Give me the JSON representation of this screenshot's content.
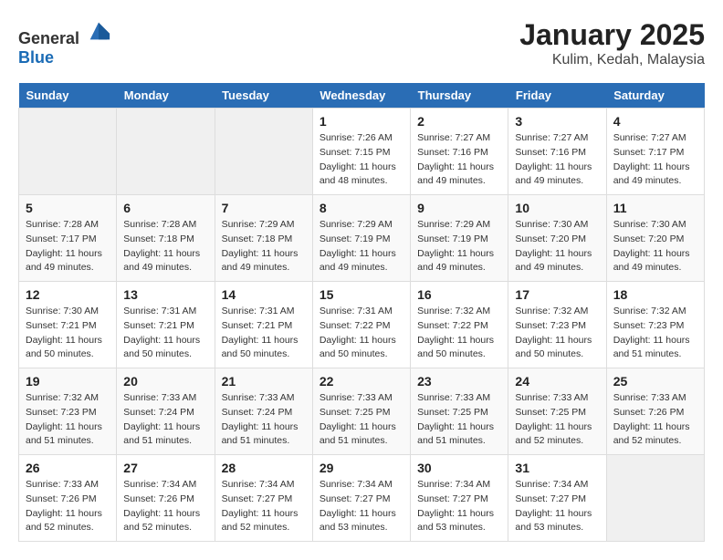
{
  "logo": {
    "text_general": "General",
    "text_blue": "Blue"
  },
  "title": "January 2025",
  "subtitle": "Kulim, Kedah, Malaysia",
  "headers": [
    "Sunday",
    "Monday",
    "Tuesday",
    "Wednesday",
    "Thursday",
    "Friday",
    "Saturday"
  ],
  "weeks": [
    [
      {
        "day": "",
        "info": ""
      },
      {
        "day": "",
        "info": ""
      },
      {
        "day": "",
        "info": ""
      },
      {
        "day": "1",
        "info": "Sunrise: 7:26 AM\nSunset: 7:15 PM\nDaylight: 11 hours\nand 48 minutes."
      },
      {
        "day": "2",
        "info": "Sunrise: 7:27 AM\nSunset: 7:16 PM\nDaylight: 11 hours\nand 49 minutes."
      },
      {
        "day": "3",
        "info": "Sunrise: 7:27 AM\nSunset: 7:16 PM\nDaylight: 11 hours\nand 49 minutes."
      },
      {
        "day": "4",
        "info": "Sunrise: 7:27 AM\nSunset: 7:17 PM\nDaylight: 11 hours\nand 49 minutes."
      }
    ],
    [
      {
        "day": "5",
        "info": "Sunrise: 7:28 AM\nSunset: 7:17 PM\nDaylight: 11 hours\nand 49 minutes."
      },
      {
        "day": "6",
        "info": "Sunrise: 7:28 AM\nSunset: 7:18 PM\nDaylight: 11 hours\nand 49 minutes."
      },
      {
        "day": "7",
        "info": "Sunrise: 7:29 AM\nSunset: 7:18 PM\nDaylight: 11 hours\nand 49 minutes."
      },
      {
        "day": "8",
        "info": "Sunrise: 7:29 AM\nSunset: 7:19 PM\nDaylight: 11 hours\nand 49 minutes."
      },
      {
        "day": "9",
        "info": "Sunrise: 7:29 AM\nSunset: 7:19 PM\nDaylight: 11 hours\nand 49 minutes."
      },
      {
        "day": "10",
        "info": "Sunrise: 7:30 AM\nSunset: 7:20 PM\nDaylight: 11 hours\nand 49 minutes."
      },
      {
        "day": "11",
        "info": "Sunrise: 7:30 AM\nSunset: 7:20 PM\nDaylight: 11 hours\nand 49 minutes."
      }
    ],
    [
      {
        "day": "12",
        "info": "Sunrise: 7:30 AM\nSunset: 7:21 PM\nDaylight: 11 hours\nand 50 minutes."
      },
      {
        "day": "13",
        "info": "Sunrise: 7:31 AM\nSunset: 7:21 PM\nDaylight: 11 hours\nand 50 minutes."
      },
      {
        "day": "14",
        "info": "Sunrise: 7:31 AM\nSunset: 7:21 PM\nDaylight: 11 hours\nand 50 minutes."
      },
      {
        "day": "15",
        "info": "Sunrise: 7:31 AM\nSunset: 7:22 PM\nDaylight: 11 hours\nand 50 minutes."
      },
      {
        "day": "16",
        "info": "Sunrise: 7:32 AM\nSunset: 7:22 PM\nDaylight: 11 hours\nand 50 minutes."
      },
      {
        "day": "17",
        "info": "Sunrise: 7:32 AM\nSunset: 7:23 PM\nDaylight: 11 hours\nand 50 minutes."
      },
      {
        "day": "18",
        "info": "Sunrise: 7:32 AM\nSunset: 7:23 PM\nDaylight: 11 hours\nand 51 minutes."
      }
    ],
    [
      {
        "day": "19",
        "info": "Sunrise: 7:32 AM\nSunset: 7:23 PM\nDaylight: 11 hours\nand 51 minutes."
      },
      {
        "day": "20",
        "info": "Sunrise: 7:33 AM\nSunset: 7:24 PM\nDaylight: 11 hours\nand 51 minutes."
      },
      {
        "day": "21",
        "info": "Sunrise: 7:33 AM\nSunset: 7:24 PM\nDaylight: 11 hours\nand 51 minutes."
      },
      {
        "day": "22",
        "info": "Sunrise: 7:33 AM\nSunset: 7:25 PM\nDaylight: 11 hours\nand 51 minutes."
      },
      {
        "day": "23",
        "info": "Sunrise: 7:33 AM\nSunset: 7:25 PM\nDaylight: 11 hours\nand 51 minutes."
      },
      {
        "day": "24",
        "info": "Sunrise: 7:33 AM\nSunset: 7:25 PM\nDaylight: 11 hours\nand 52 minutes."
      },
      {
        "day": "25",
        "info": "Sunrise: 7:33 AM\nSunset: 7:26 PM\nDaylight: 11 hours\nand 52 minutes."
      }
    ],
    [
      {
        "day": "26",
        "info": "Sunrise: 7:33 AM\nSunset: 7:26 PM\nDaylight: 11 hours\nand 52 minutes."
      },
      {
        "day": "27",
        "info": "Sunrise: 7:34 AM\nSunset: 7:26 PM\nDaylight: 11 hours\nand 52 minutes."
      },
      {
        "day": "28",
        "info": "Sunrise: 7:34 AM\nSunset: 7:27 PM\nDaylight: 11 hours\nand 52 minutes."
      },
      {
        "day": "29",
        "info": "Sunrise: 7:34 AM\nSunset: 7:27 PM\nDaylight: 11 hours\nand 53 minutes."
      },
      {
        "day": "30",
        "info": "Sunrise: 7:34 AM\nSunset: 7:27 PM\nDaylight: 11 hours\nand 53 minutes."
      },
      {
        "day": "31",
        "info": "Sunrise: 7:34 AM\nSunset: 7:27 PM\nDaylight: 11 hours\nand 53 minutes."
      },
      {
        "day": "",
        "info": ""
      }
    ]
  ]
}
